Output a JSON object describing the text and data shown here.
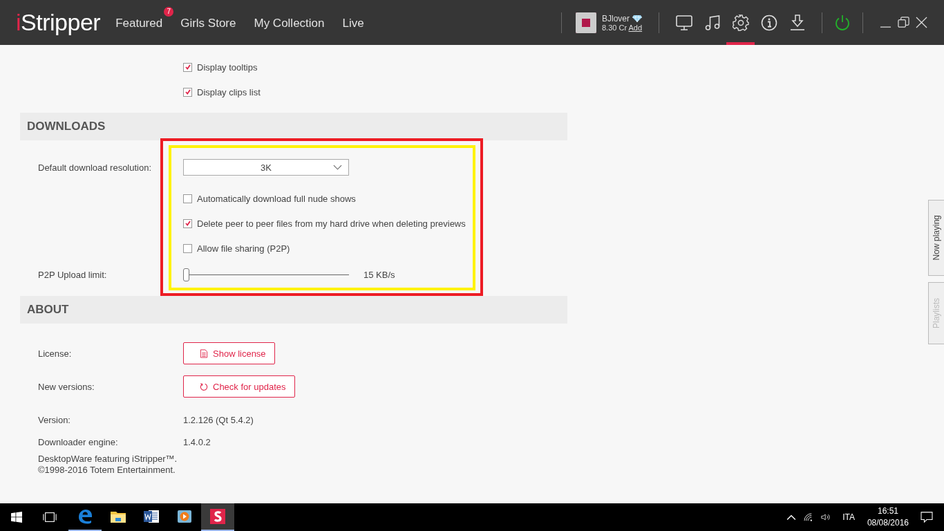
{
  "app_bar": {
    "logo": {
      "accent": "i",
      "rest": "Stripper"
    },
    "nav": [
      {
        "label": "Featured",
        "badge": "7"
      },
      {
        "label": "Girls Store"
      },
      {
        "label": "My Collection"
      },
      {
        "label": "Live"
      }
    ],
    "account": {
      "username": "BJlover",
      "credits": "8.30 Cr",
      "add_link": "Add"
    },
    "toolbar": [
      {
        "kind": "monitor",
        "selected": false
      },
      {
        "kind": "music",
        "selected": false
      },
      {
        "kind": "settings",
        "selected": true
      },
      {
        "kind": "info",
        "selected": false
      },
      {
        "kind": "download",
        "selected": false
      }
    ]
  },
  "display_options": [
    {
      "label": "Display tooltips",
      "checked": true
    },
    {
      "label": "Display clips list",
      "checked": true
    }
  ],
  "downloads": {
    "title": "DOWNLOADS",
    "resolution": {
      "label": "Default download resolution:",
      "value": "3K"
    },
    "options": [
      {
        "label": "Automatically download full nude shows",
        "checked": false
      },
      {
        "label": "Delete peer to peer files from my hard drive when deleting previews",
        "checked": true
      },
      {
        "label": "Allow file sharing (P2P)",
        "checked": false
      }
    ],
    "upload": {
      "label": "P2P Upload limit:",
      "level": 0,
      "reading": "15 KB/s"
    }
  },
  "about": {
    "title": "ABOUT",
    "rows": [
      {
        "kind": "document_button",
        "label": "License:",
        "button": "Show license"
      },
      {
        "kind": "refresh_button",
        "label": "New versions:",
        "button": "Check for updates"
      },
      {
        "kind": "text",
        "label": "Version:",
        "value": "1.2.126 (Qt 5.4.2)"
      },
      {
        "kind": "text",
        "label": "Downloader engine:",
        "value": "1.4.0.2"
      }
    ],
    "footer": [
      "DesktopWare featuring iStripper™.",
      "©1998-2016 Totem Entertainment."
    ]
  },
  "side_tabs": [
    {
      "label": "Now playing",
      "disabled": false
    },
    {
      "label": "Playlists",
      "disabled": true
    }
  ],
  "taskbar": {
    "apps": [
      {
        "kind": "edge",
        "running": true,
        "selected": false
      },
      {
        "kind": "explorer",
        "running": false,
        "selected": false
      },
      {
        "kind": "word",
        "running": false,
        "selected": false
      },
      {
        "kind": "media",
        "running": false,
        "selected": false
      },
      {
        "kind": "istripper",
        "running": true,
        "selected": true
      }
    ],
    "language": "ITA",
    "time": "16:51",
    "date": "08/08/2016"
  }
}
